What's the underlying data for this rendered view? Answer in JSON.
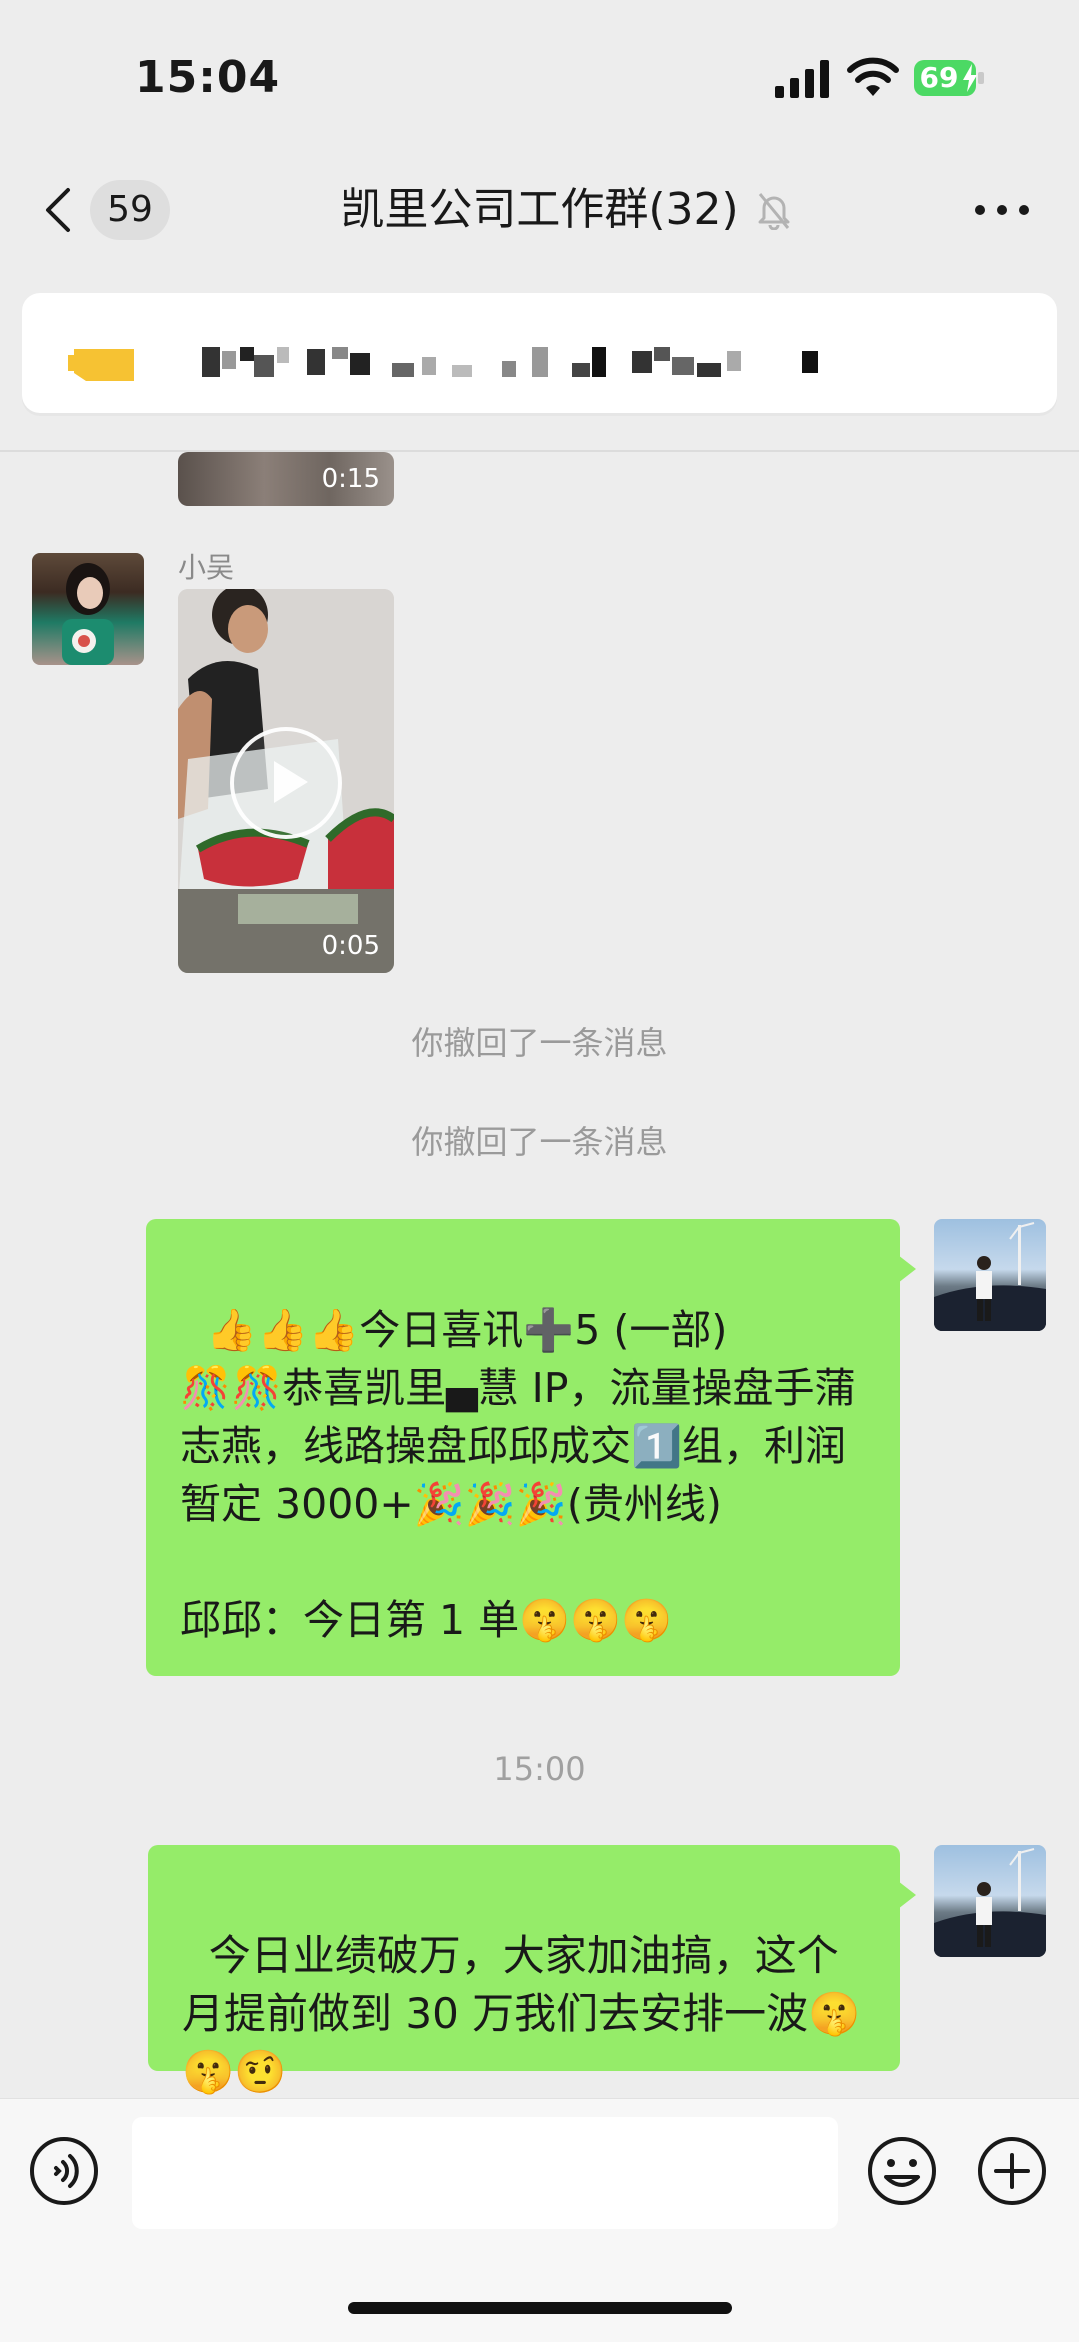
{
  "status_bar": {
    "time": "15:04",
    "battery": "69"
  },
  "header": {
    "unread_count": "59",
    "title": "凯里公司工作群(32)"
  },
  "pinned_notice": {
    "text": ""
  },
  "messages": {
    "video1": {
      "duration": "0:15"
    },
    "xiaowu": {
      "sender": "小吴",
      "duration": "0:05"
    },
    "recall1": "你撤回了一条消息",
    "recall2": "你撤回了一条消息",
    "announcement": "👍👍👍今日喜讯➕5 (一部)\n🎊🎊恭喜凯里▄慧 IP，流量操盘手蒲志燕，线路操盘邱邱成交1️⃣组，利润暂定 3000+🎉🎉🎉(贵州线)\n\n邱邱：今日第 1 单🤫🤫🤫",
    "timestamp": "15:00",
    "performance": "今日业绩破万，大家加油搞，这个月提前做到 30 万我们去安排一波🤫🤫🤨"
  },
  "composer": {
    "placeholder": ""
  },
  "colors": {
    "bubble": "#95ec69",
    "background": "#ededed",
    "battery": "#4cd964"
  }
}
